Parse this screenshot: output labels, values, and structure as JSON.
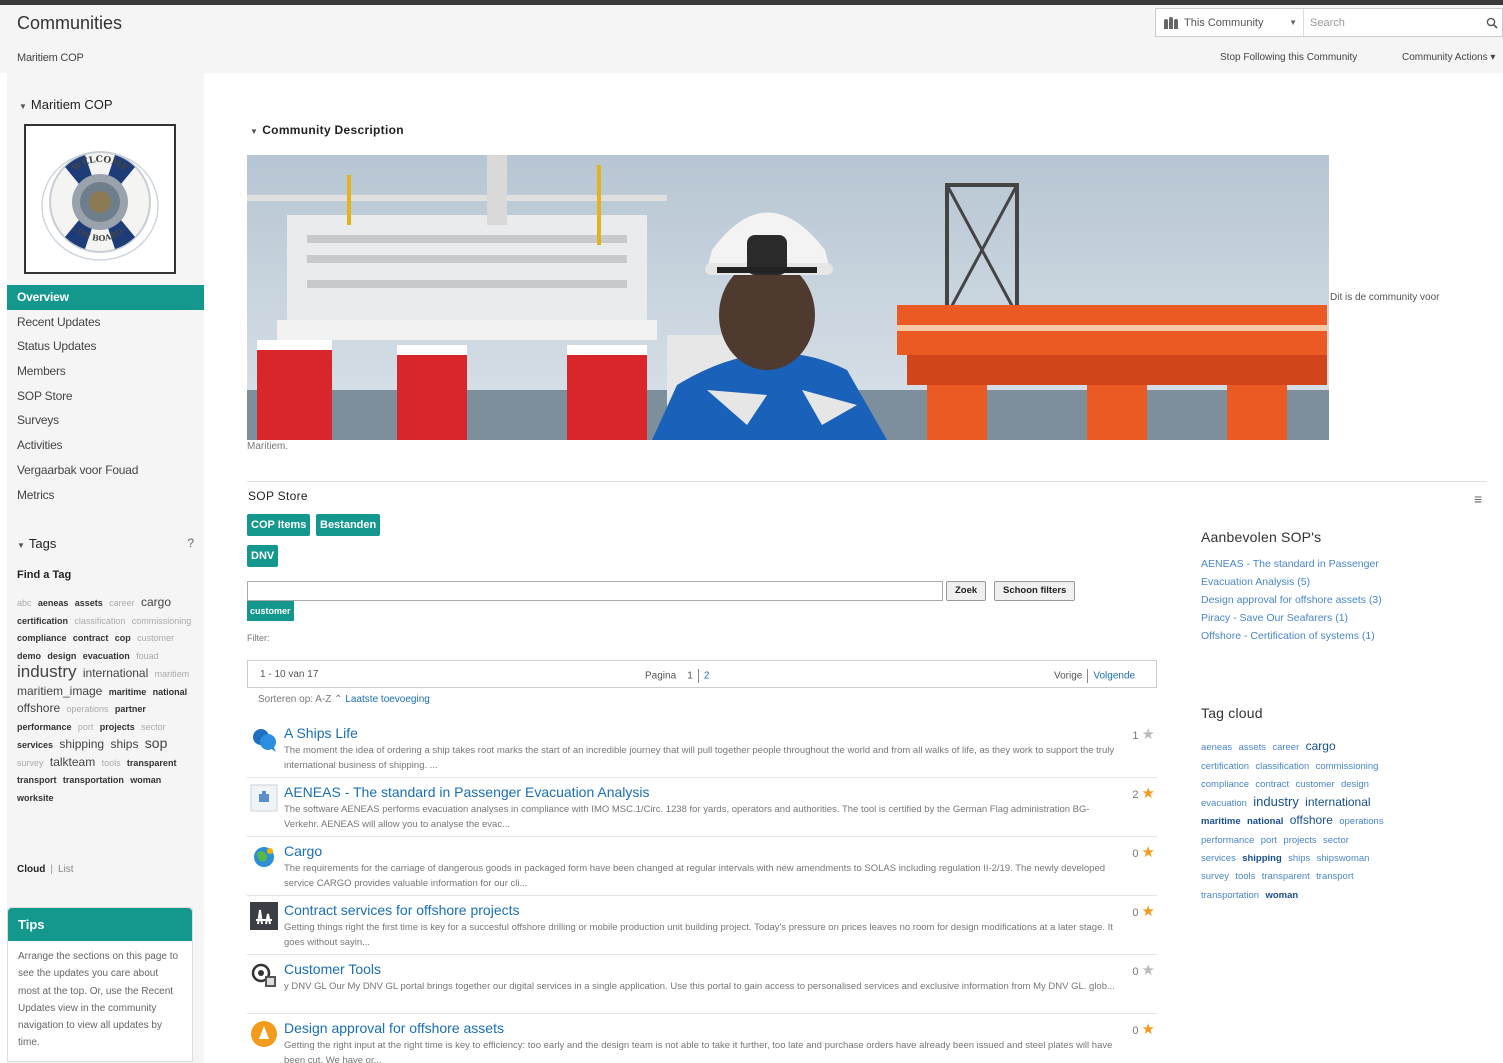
{
  "header": {
    "title": "Communities",
    "subtitle": "Maritiem COP",
    "search_scope": "This Community",
    "search_placeholder": "Search",
    "follow_label": "Stop Following this Community",
    "actions_label": "Community Actions ▾"
  },
  "sidebar": {
    "section_title": "Maritiem COP",
    "logo_text_top": "WELCOME",
    "logo_text_bottom": "ON BOARD",
    "nav": [
      {
        "label": "Overview",
        "active": true
      },
      {
        "label": "Recent Updates"
      },
      {
        "label": "Status Updates"
      },
      {
        "label": "Members"
      },
      {
        "label": "SOP Store"
      },
      {
        "label": "Surveys"
      },
      {
        "label": "Activities"
      },
      {
        "label": "Vergaarbak voor Fouad"
      },
      {
        "label": "Metrics"
      }
    ],
    "tags_title": "Tags",
    "tags_help": "?",
    "find_tag": "Find a Tag",
    "tags": [
      {
        "text": "abc",
        "size": "xs"
      },
      {
        "text": "aeneas",
        "size": "sb"
      },
      {
        "text": "assets",
        "size": "sb"
      },
      {
        "text": "career",
        "size": "xs"
      },
      {
        "text": "cargo",
        "size": "md"
      },
      {
        "text": "certification",
        "size": "sb"
      },
      {
        "text": "classification",
        "size": "xs"
      },
      {
        "text": "commissioning",
        "size": "xs"
      },
      {
        "text": "compliance",
        "size": "sb"
      },
      {
        "text": "contract",
        "size": "sb"
      },
      {
        "text": "cop",
        "size": "sb"
      },
      {
        "text": "customer",
        "size": "xs"
      },
      {
        "text": "demo",
        "size": "sb"
      },
      {
        "text": "design",
        "size": "sb"
      },
      {
        "text": "evacuation",
        "size": "sb"
      },
      {
        "text": "fouad",
        "size": "xs"
      },
      {
        "text": "industry",
        "size": "lg"
      },
      {
        "text": "international",
        "size": "md"
      },
      {
        "text": "maritiem",
        "size": "xs"
      },
      {
        "text": "maritiem_image",
        "size": "md"
      },
      {
        "text": "maritime",
        "size": "sb"
      },
      {
        "text": "national",
        "size": "sb"
      },
      {
        "text": "offshore",
        "size": "md"
      },
      {
        "text": "operations",
        "size": "xs"
      },
      {
        "text": "partner",
        "size": "sb"
      },
      {
        "text": "performance",
        "size": "sb"
      },
      {
        "text": "port",
        "size": "xs"
      },
      {
        "text": "projects",
        "size": "sb"
      },
      {
        "text": "sector",
        "size": "xs"
      },
      {
        "text": "services",
        "size": "sb"
      },
      {
        "text": "shipping",
        "size": "md"
      },
      {
        "text": "ships",
        "size": "md"
      },
      {
        "text": "sop",
        "size": "ml"
      },
      {
        "text": "survey",
        "size": "xs"
      },
      {
        "text": "talkteam",
        "size": "md"
      },
      {
        "text": "tools",
        "size": "xs"
      },
      {
        "text": "transparent",
        "size": "sb"
      },
      {
        "text": "transport",
        "size": "sb"
      },
      {
        "text": "transportation",
        "size": "sb"
      },
      {
        "text": "woman",
        "size": "sb"
      },
      {
        "text": "worksite",
        "size": "sb"
      }
    ],
    "cloud_label": "Cloud",
    "list_label": "List",
    "tips_title": "Tips",
    "tips_body": "Arrange the sections on this page to see the updates you care about most at the top. Or, use the Recent Updates view in the community navigation to view all updates by time."
  },
  "main": {
    "description_title": "Community Description",
    "hero_caption_right": "Dit is de community voor",
    "hero_caption_below": "Maritiem.",
    "sop_title": "SOP Store",
    "btn_cop_items": "COP Items",
    "btn_bestanden": "Bestanden",
    "btn_dnv": "DNV",
    "btn_zoek": "Zoek",
    "btn_schoon": "Schoon filters",
    "tag_chip": "customer",
    "filter_label": "Filter:",
    "pager": {
      "count": "1 - 10 van 17",
      "page_label": "Pagina",
      "page1": "1",
      "page2": "2",
      "prev": "Vorige",
      "next": "Volgende"
    },
    "sort_label": "Sorteren op:",
    "sort_az": "A-Z",
    "sort_recent": "Laatste toevoeging",
    "results": [
      {
        "title": "A Ships Life",
        "desc": "The moment the idea of ordering a ship takes root marks the start of an incredible journey that will pull together people throughout the world and from all walks of life, as they work to support the truly international business of shipping. ...",
        "rating": "1",
        "star": "off",
        "icon": "chat-bubbles-icon"
      },
      {
        "title": "AENEAS - The standard in Passenger Evacuation Analysis",
        "desc": "The software AENEAS performs evacuation analyses in compliance with IMO MSC.1/Circ. 1238 for yards, operators and authorities. The tool is certified by the German Flag administration BG-Verkehr. AENEAS will allow you to analyse the evac...",
        "rating": "2",
        "star": "on",
        "icon": "document-thumbnail-icon"
      },
      {
        "title": "Cargo",
        "desc": "The requirements for the carriage of dangerous goods in packaged form have been changed at regular intervals with new amendments to SOLAS including regulation II-2/19. The newly developed service CARGO provides valuable information for our cli...",
        "rating": "0",
        "star": "on",
        "icon": "globe-icon"
      },
      {
        "title": "Contract services for offshore projects",
        "desc": "Getting things right the first time is key for a succesful offshore drilling or mobile production unit building project. Today's pressure on prices leaves no room for design modifications at a later stage. It goes without sayin...",
        "rating": "0",
        "star": "on",
        "icon": "rig-icon"
      },
      {
        "title": "Customer Tools",
        "desc": "y DNV GL Our My DNV GL portal brings together our digital services in a single application. Use this portal to gain access to personalised services and exclusive information from My DNV GL.    glob...",
        "rating": "0",
        "star": "off",
        "icon": "tools-icon"
      },
      {
        "title": "Design approval for offshore assets",
        "desc": "Getting the right input at the right time is key to efficiency: too early and the design team is not able to take it further, too late and purchase orders have already been issued and steel plates will have been cut. We have or...",
        "rating": "0",
        "star": "on",
        "icon": "badge-icon"
      }
    ],
    "recommended_title": "Aanbevolen SOP's",
    "recommended": [
      "AENEAS - The standard in Passenger Evacuation Analysis (5)",
      "Design approval for offshore assets (3)",
      "Piracy - Save Our Seafarers (1)",
      "Offshore - Certification of systems (1)"
    ],
    "tagcloud_title": "Tag cloud",
    "tagcloud": [
      {
        "text": "aeneas",
        "size": "s"
      },
      {
        "text": "assets",
        "size": "s"
      },
      {
        "text": "career",
        "size": "s"
      },
      {
        "text": "cargo",
        "size": "m"
      },
      {
        "text": "certification",
        "size": "s"
      },
      {
        "text": "classification",
        "size": "s"
      },
      {
        "text": "commissioning",
        "size": "s"
      },
      {
        "text": "compliance",
        "size": "s"
      },
      {
        "text": "contract",
        "size": "s"
      },
      {
        "text": "customer",
        "size": "s"
      },
      {
        "text": "design",
        "size": "s"
      },
      {
        "text": "evacuation",
        "size": "s"
      },
      {
        "text": "industry",
        "size": "l"
      },
      {
        "text": "international",
        "size": "m"
      },
      {
        "text": "maritime",
        "size": "b"
      },
      {
        "text": "national",
        "size": "b"
      },
      {
        "text": "offshore",
        "size": "m"
      },
      {
        "text": "operations",
        "size": "s"
      },
      {
        "text": "performance",
        "size": "s"
      },
      {
        "text": "port",
        "size": "s"
      },
      {
        "text": "projects",
        "size": "s"
      },
      {
        "text": "sector",
        "size": "s"
      },
      {
        "text": "services",
        "size": "s"
      },
      {
        "text": "shipping",
        "size": "b"
      },
      {
        "text": "ships",
        "size": "s"
      },
      {
        "text": "shipswoman",
        "size": "s"
      },
      {
        "text": "survey",
        "size": "s"
      },
      {
        "text": "tools",
        "size": "s"
      },
      {
        "text": "transparent",
        "size": "s"
      },
      {
        "text": "transport",
        "size": "s"
      },
      {
        "text": "transportation",
        "size": "s"
      },
      {
        "text": "woman",
        "size": "b"
      }
    ]
  }
}
